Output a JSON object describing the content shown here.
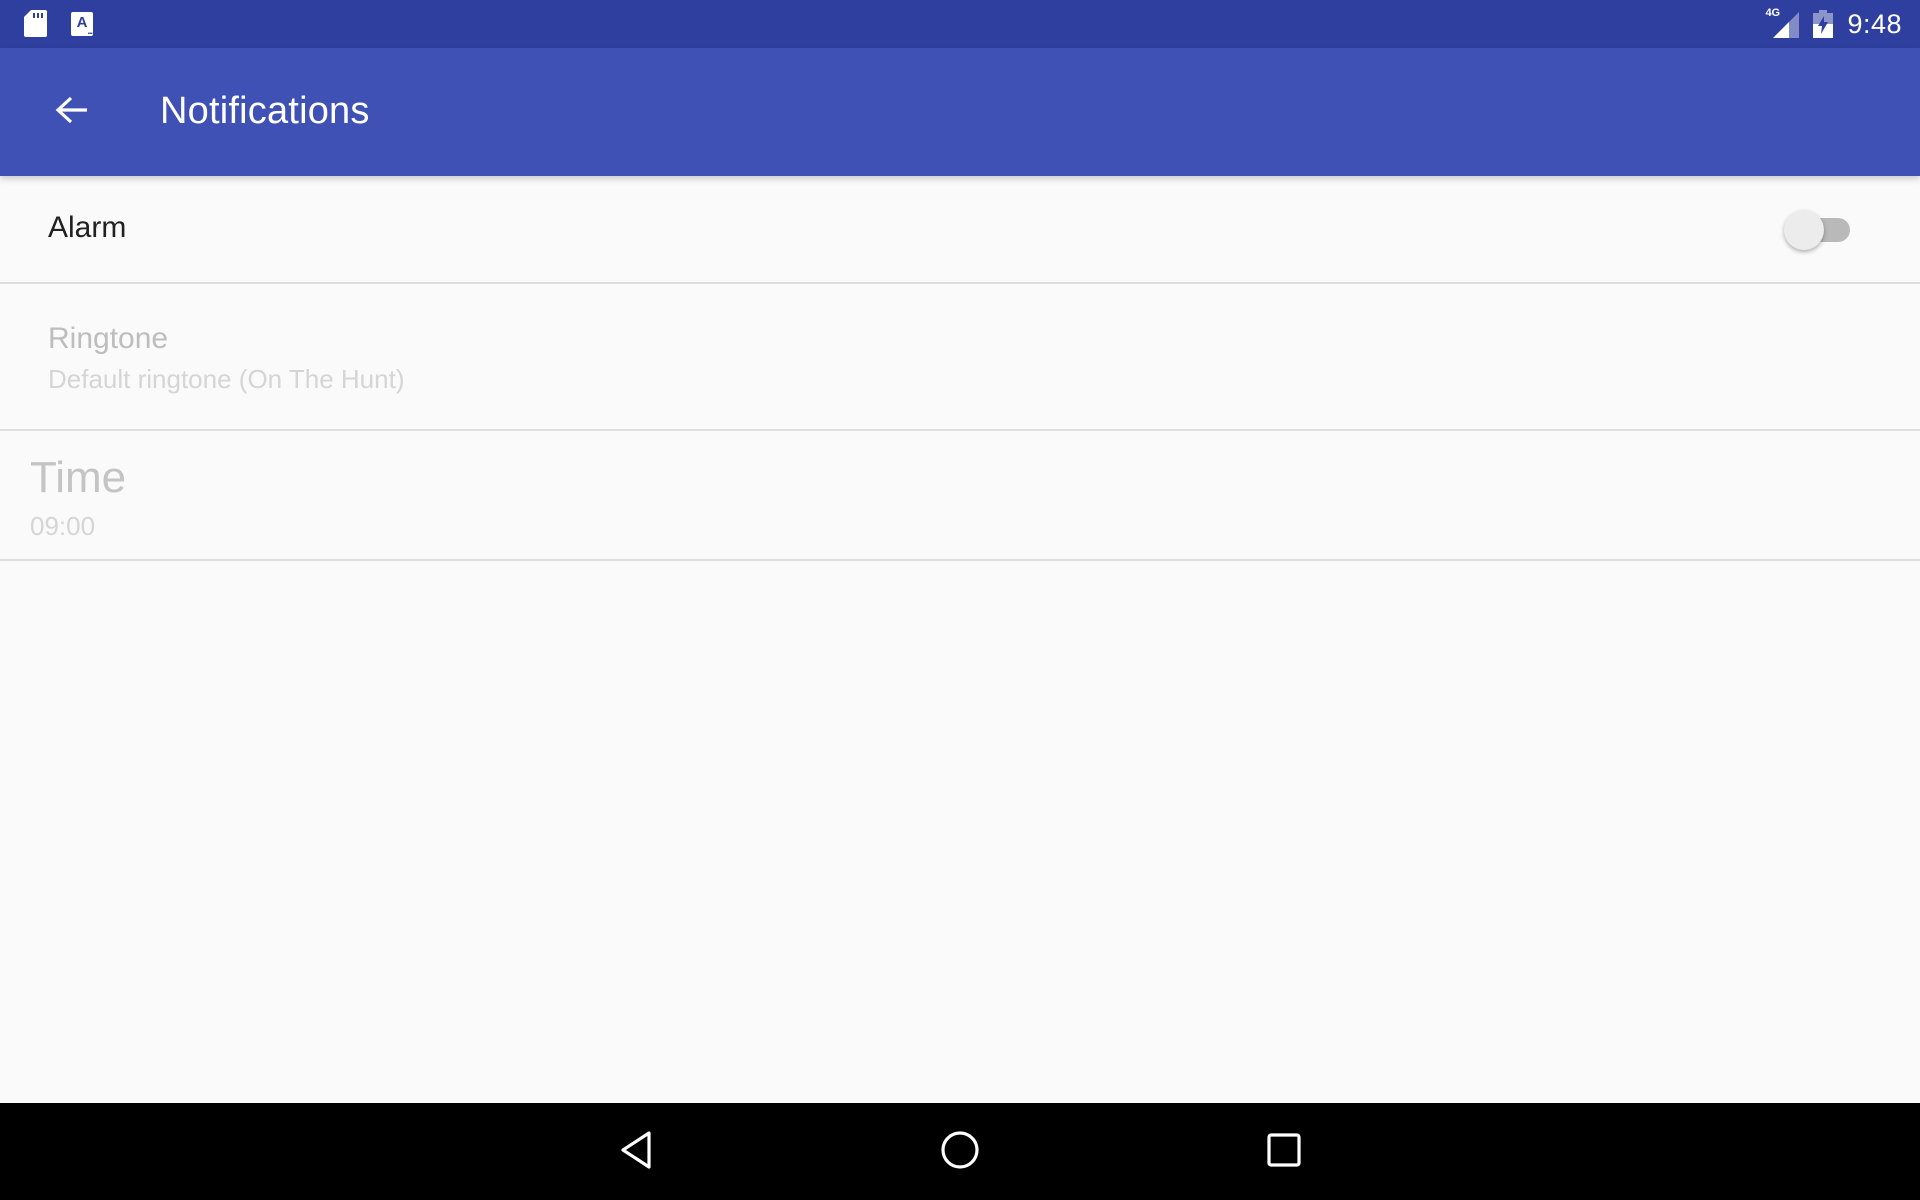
{
  "status_bar": {
    "left_icons": [
      "sd-card-icon",
      "app-notification-a-icon"
    ],
    "network_label": "4G",
    "clock": "9:48",
    "right_icons": [
      "signal-icon",
      "battery-charging-icon"
    ]
  },
  "app_bar": {
    "back_icon": "arrow-back-icon",
    "title": "Notifications",
    "color": "#3f51b5"
  },
  "preferences": [
    {
      "key": "alarm",
      "title": "Alarm",
      "type": "switch",
      "checked": false
    },
    {
      "key": "ringtone",
      "title": "Ringtone",
      "summary": "Default ringtone (On The Hunt)",
      "enabled": false
    },
    {
      "key": "time",
      "title": "Time",
      "summary": "09:00",
      "enabled": false
    }
  ],
  "nav_bar": {
    "buttons": [
      "back",
      "home",
      "recents"
    ]
  },
  "colors": {
    "status_bar": "#2f3f9f",
    "primary": "#3f51b5",
    "background": "#fafafa",
    "switch_track_off": "#b9b9b9",
    "switch_thumb_off": "#ececec"
  }
}
